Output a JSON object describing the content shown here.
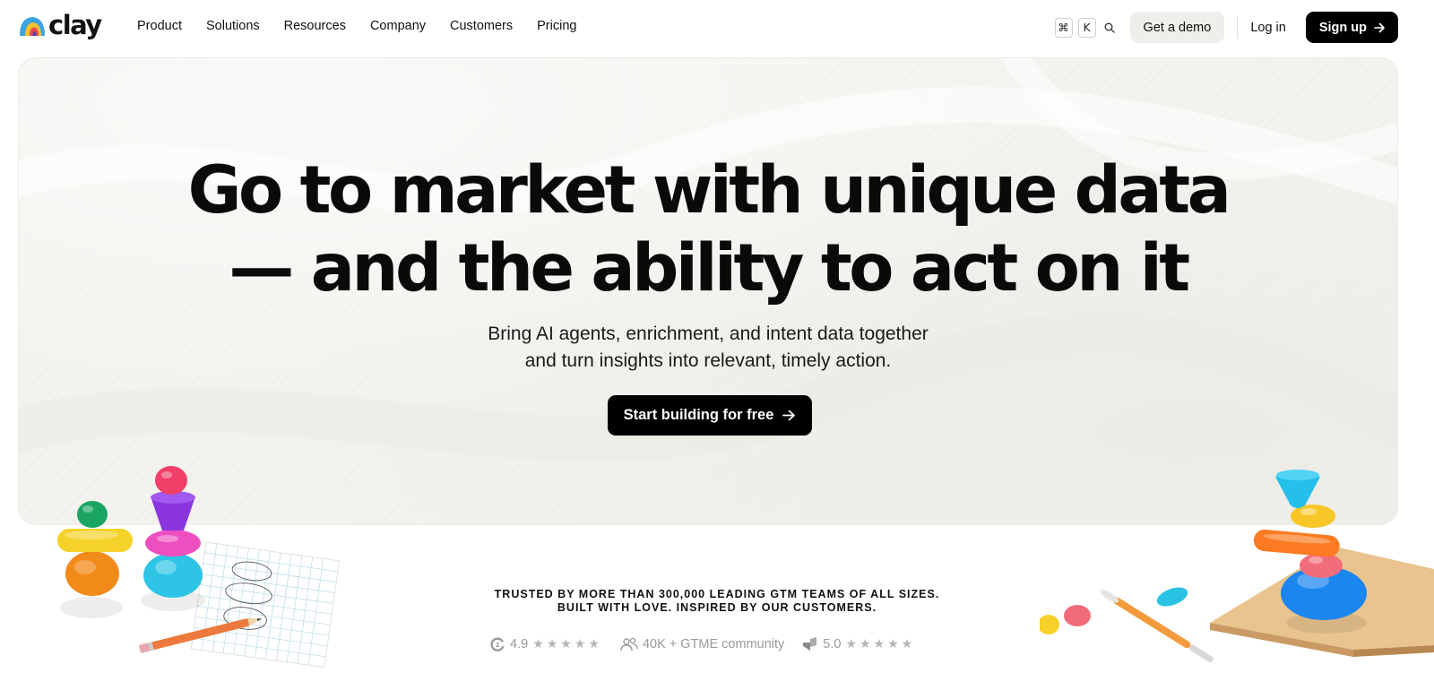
{
  "brand": {
    "name": "clay"
  },
  "nav": {
    "links": [
      "Product",
      "Solutions",
      "Resources",
      "Company",
      "Customers",
      "Pricing"
    ],
    "shortcut_keys": [
      "⌘",
      "K"
    ],
    "demo_label": "Get a demo",
    "login_label": "Log in",
    "signup_label": "Sign up"
  },
  "hero": {
    "headline_line1": "Go to market with unique data",
    "headline_line2": "— and the ability to act on it",
    "subhead_line1": "Bring AI agents, enrichment, and intent data together",
    "subhead_line2": "and turn insights into relevant, timely action.",
    "cta_label": "Start building for free"
  },
  "trust": {
    "line1": "TRUSTED BY MORE THAN 300,000 LEADING GTM TEAMS OF ALL SIZES.",
    "line2": "BUILT WITH LOVE. INSPIRED BY OUR CUSTOMERS.",
    "ratings": [
      {
        "icon": "g2-icon",
        "value": "4.9",
        "stars": "★★★★★"
      },
      {
        "icon": "community-icon",
        "value": "40K + GTME community"
      },
      {
        "icon": "capterra-icon",
        "value": "5.0",
        "stars": "★★★★★"
      }
    ]
  },
  "colors": {
    "primary": "#000000",
    "hero_bg": "#f4f3ef",
    "demo_bg": "#efeeea",
    "muted_text": "#9a9a9a"
  }
}
